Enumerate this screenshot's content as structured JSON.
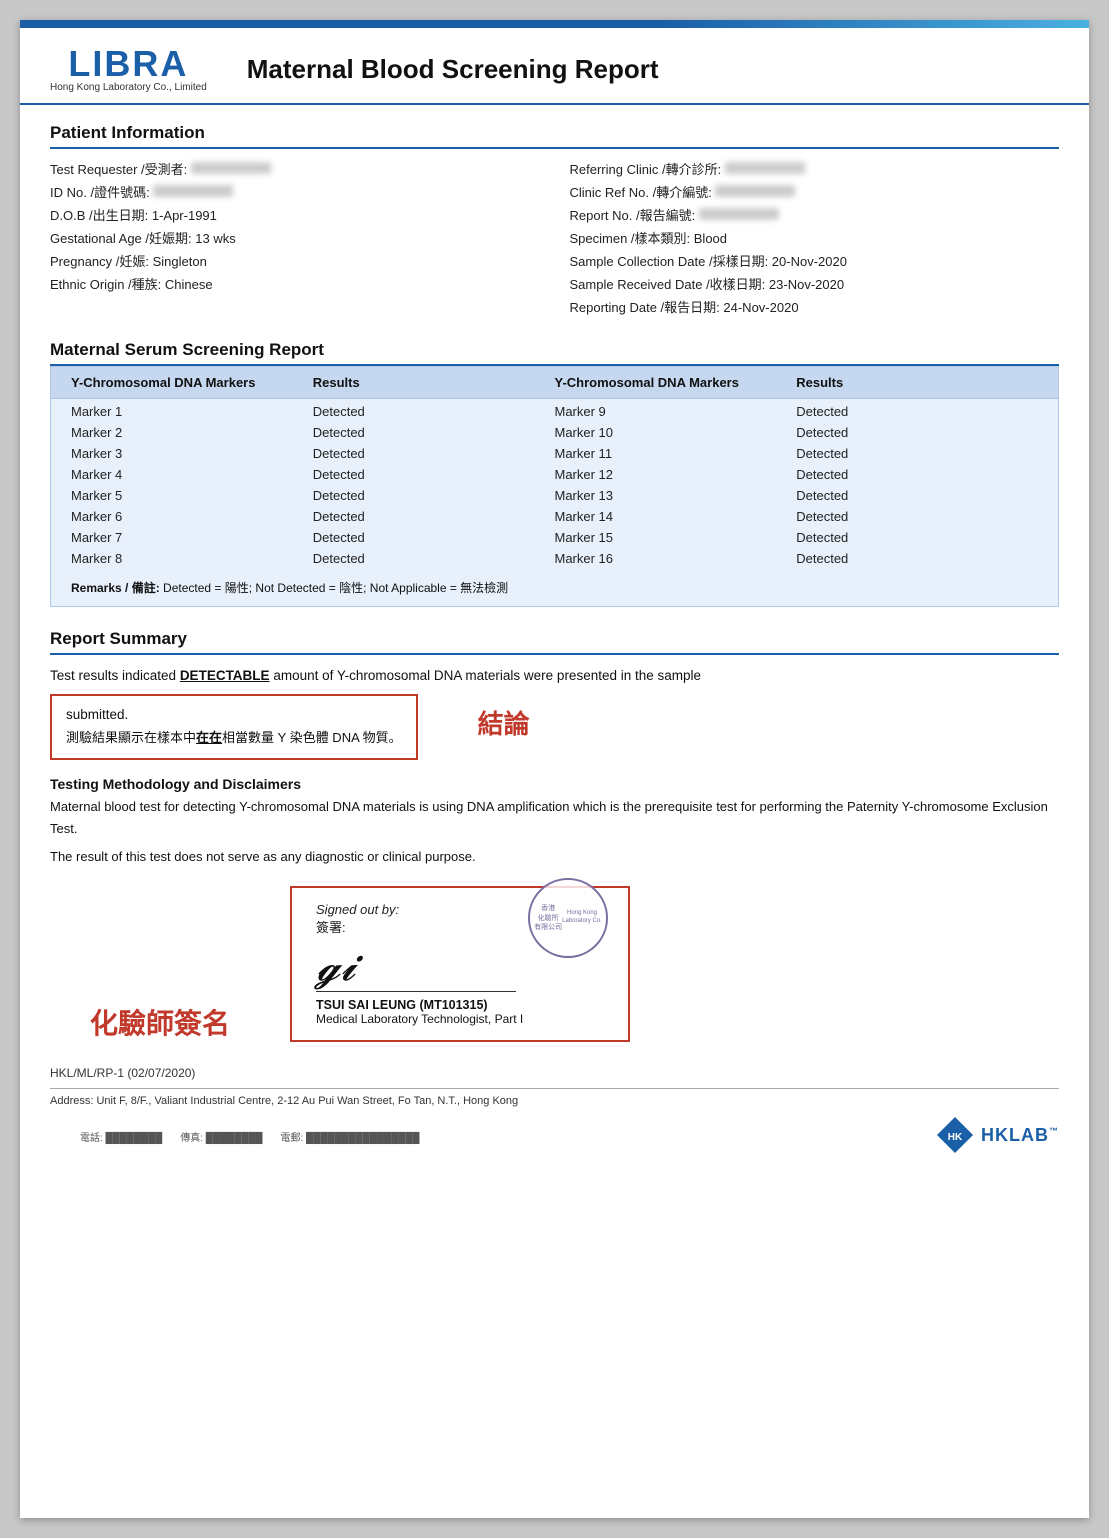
{
  "page": {
    "title": "Maternal Blood Screening Report"
  },
  "logo": {
    "text": "LIBRA",
    "subtitle": "Hong Kong Laboratory Co., Limited"
  },
  "header": {
    "report_title": "Maternal Blood Screening Report"
  },
  "patient_info": {
    "section_title": "Patient Information",
    "fields_left": [
      {
        "label": "Test Requester /受測者:",
        "value": "REDACTED"
      },
      {
        "label": "ID No. /證件號碼:",
        "value": "REDACTED"
      },
      {
        "label": "D.O.B /出生日期:",
        "value": "1-Apr-1991"
      },
      {
        "label": "Gestational Age /妊娠期:",
        "value": "13 wks"
      },
      {
        "label": "Pregnancy /妊娠:",
        "value": "Singleton"
      },
      {
        "label": "Ethnic Origin /種族:",
        "value": "Chinese"
      }
    ],
    "fields_right": [
      {
        "label": "Referring Clinic /轉介診所:",
        "value": "REDACTED"
      },
      {
        "label": "Clinic Ref No. /轉介編號:",
        "value": "REDACTED"
      },
      {
        "label": "Report No. /報告編號:",
        "value": "REDACTED"
      },
      {
        "label": "Specimen /樣本類別:",
        "value": "Blood"
      },
      {
        "label": "Sample Collection Date /採樣日期:",
        "value": "20-Nov-2020"
      },
      {
        "label": "Sample Received Date /收樣日期:",
        "value": "23-Nov-2020"
      },
      {
        "label": "Reporting Date /報告日期:",
        "value": "24-Nov-2020"
      }
    ]
  },
  "serum_screening": {
    "section_title": "Maternal Serum Screening Report",
    "table_headers": [
      "Y-Chromosomal DNA Markers",
      "Results",
      "Y-Chromosomal DNA Markers",
      "Results"
    ],
    "markers_left": [
      {
        "marker": "Marker 1",
        "result": "Detected"
      },
      {
        "marker": "Marker 2",
        "result": "Detected"
      },
      {
        "marker": "Marker 3",
        "result": "Detected"
      },
      {
        "marker": "Marker 4",
        "result": "Detected"
      },
      {
        "marker": "Marker 5",
        "result": "Detected"
      },
      {
        "marker": "Marker 6",
        "result": "Detected"
      },
      {
        "marker": "Marker 7",
        "result": "Detected"
      },
      {
        "marker": "Marker 8",
        "result": "Detected"
      }
    ],
    "markers_right": [
      {
        "marker": "Marker 9",
        "result": "Detected"
      },
      {
        "marker": "Marker 10",
        "result": "Detected"
      },
      {
        "marker": "Marker 11",
        "result": "Detected"
      },
      {
        "marker": "Marker 12",
        "result": "Detected"
      },
      {
        "marker": "Marker 13",
        "result": "Detected"
      },
      {
        "marker": "Marker 14",
        "result": "Detected"
      },
      {
        "marker": "Marker 15",
        "result": "Detected"
      },
      {
        "marker": "Marker 16",
        "result": "Detected"
      }
    ],
    "remarks": "Remarks / 備註: Detected = 陽性; Not Detected = 陰性; Not Applicable = 無法檢測"
  },
  "report_summary": {
    "section_title": "Report Summary",
    "summary_line1": "Test results indicated ",
    "detectable": "DETECTABLE",
    "summary_line2": " amount of Y-chromosomal DNA materials were presented in the sample",
    "submitted": "submitted.",
    "chinese_text_prefix": "測驗結果顯示在樣本中",
    "chinese_underline": "在在",
    "chinese_text_suffix": "相當數量 Y 染色體 DNA 物質。",
    "conclusion_label": "結論"
  },
  "methodology": {
    "title": "Testing Methodology and Disclaimers",
    "text1": "Maternal blood test for detecting Y-chromosomal DNA materials is using DNA amplification which is the prerequisite test for performing the Paternity Y-chromosome Exclusion Test.",
    "text2": "The result of this test does not serve as any diagnostic or clinical purpose."
  },
  "signature": {
    "chemist_label": "化驗師簽名",
    "signed_out_by": "Signed out by:",
    "signed_label_zh": "簽署:",
    "signer_name": "TSUI SAI LEUNG (MT101315)",
    "signer_title": "Medical Laboratory Technologist, Part I",
    "stamp_text": "香港\n化驗所\n有限公司\nHong Kong\nLaboratory Co."
  },
  "footer": {
    "doc_number": "HKL/ML/RP-1 (02/07/2020)",
    "address": "Address: Unit F, 8/F., Valiant Industrial Centre, 2-12 Au Pui Wan Street, Fo Tan, N.T., Hong Kong",
    "contacts": [
      "電話: (redacted)",
      "傳真: (redacted)",
      "電郵: (redacted)"
    ],
    "hklab": "HKLAB"
  }
}
